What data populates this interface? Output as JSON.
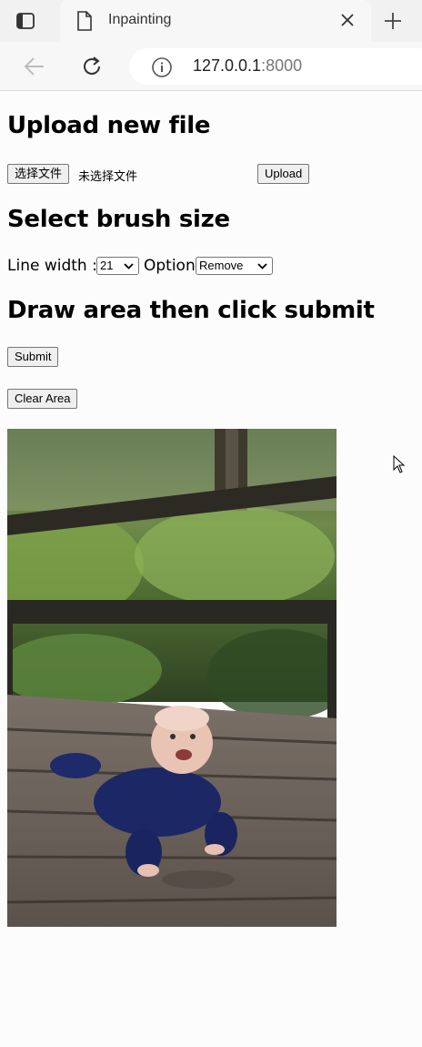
{
  "browser": {
    "tab_title": "Inpainting",
    "url_host": "127.0.0.1",
    "url_port": ":8000"
  },
  "upload": {
    "heading": "Upload new file",
    "choose_button": "选择文件",
    "file_status": "未选择文件",
    "upload_button": "Upload"
  },
  "brush": {
    "heading": "Select brush size",
    "line_width_label": "Line width :",
    "line_width_value": "21",
    "option_label": "Option",
    "option_value": "Remove"
  },
  "draw": {
    "heading": "Draw area then click submit",
    "submit_button": "Submit",
    "clear_button": "Clear Area"
  },
  "icons": {
    "sidebar": "sidebar-icon",
    "tab": "document-icon",
    "close": "close-icon",
    "new_tab": "plus-icon",
    "back": "back-arrow-icon",
    "reload": "reload-icon",
    "info": "info-icon"
  }
}
